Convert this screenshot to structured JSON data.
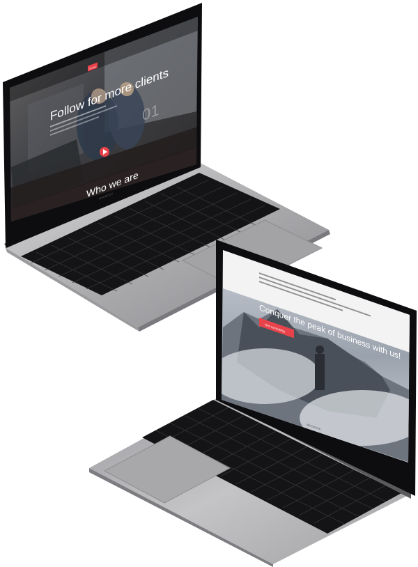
{
  "colors": {
    "accent": "#e8434a",
    "aluminum": "#b9b9bb",
    "bezel": "#0d0d0f",
    "keys": "#151517"
  },
  "laptop_top": {
    "brand": "MACBOOK",
    "nav_button": "Contact",
    "headline": "Follow for more clients",
    "slide_number": "01",
    "section_title": "Who we are"
  },
  "laptop_bottom": {
    "brand": "MACBOOK",
    "headline": "Conquer the peak of business with us!",
    "cta": "Get consulting"
  }
}
